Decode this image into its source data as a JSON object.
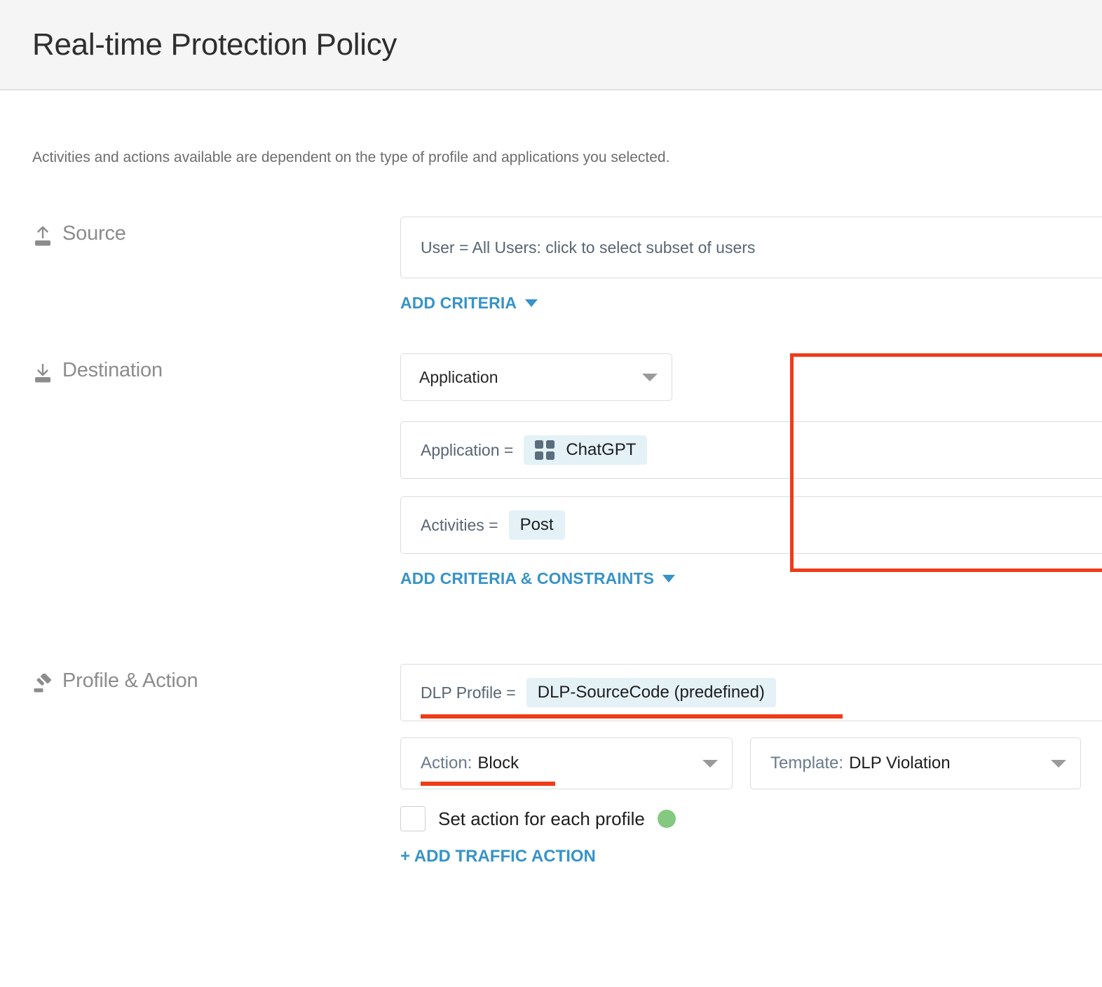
{
  "header": {
    "title": "Real-time Protection Policy"
  },
  "intro": {
    "text": "Activities and actions available are dependent on the type of profile and applications you selected."
  },
  "colors": {
    "accent_blue": "#3793c8",
    "highlight_red": "#ee3b18",
    "chip_bg": "#e4f2f7",
    "status_green": "#84c97f",
    "header_bg": "#f5f5f5"
  },
  "source": {
    "label": "Source",
    "icon": "upload-icon",
    "field_value": "User = All Users: click to select subset of users",
    "add_criteria_label": "ADD CRITERIA"
  },
  "destination": {
    "label": "Destination",
    "icon": "download-icon",
    "type_select_value": "Application",
    "criteria": [
      {
        "key": "Application =",
        "value": "ChatGPT",
        "icon": "app-grid-icon"
      },
      {
        "key": "Activities =",
        "value": "Post",
        "icon": null
      }
    ],
    "add_criteria_label": "ADD CRITERIA & CONSTRAINTS"
  },
  "profile_action": {
    "label": "Profile & Action",
    "icon": "gavel-icon",
    "dlp_profile_key": "DLP Profile =",
    "dlp_profile_value": "DLP-SourceCode (predefined)",
    "action_label": "Action:",
    "action_value": "Block",
    "template_label": "Template:",
    "template_value": "DLP Violation",
    "set_action_checkbox_label": "Set action for each profile",
    "set_action_checked": false,
    "add_traffic_action_label": "+ ADD TRAFFIC ACTION"
  }
}
